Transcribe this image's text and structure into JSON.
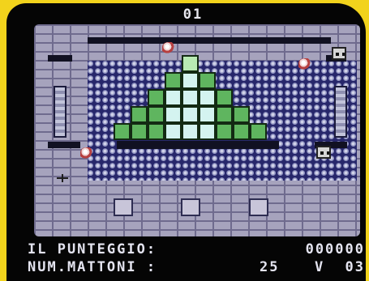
{
  "game": {
    "level_counter": "01",
    "score_label": "IL PUNTEGGIO:",
    "score_value": "000000",
    "bricks_label": "NUM.MATTONI :",
    "bricks_value": "25",
    "lives_label": "V",
    "lives_value": "03"
  },
  "colors": {
    "background_yellow": "#f2d31c",
    "crt_black": "#050505",
    "wall_brick": "#a6a3bd",
    "floor_dark": "#27276b",
    "brick_green_dark": "#5fb55f",
    "brick_green_light": "#b8eab3",
    "brick_cyan": "#d4f3f0"
  },
  "pyramid": {
    "rows": [
      {
        "count": 1,
        "light": [
          0
        ]
      },
      {
        "count": 3,
        "light": [
          1
        ]
      },
      {
        "count": 5,
        "light": [
          1,
          2,
          3
        ]
      },
      {
        "count": 7,
        "light": [
          2,
          3,
          4
        ]
      },
      {
        "count": 9,
        "light": [
          3,
          4,
          5
        ]
      }
    ]
  }
}
